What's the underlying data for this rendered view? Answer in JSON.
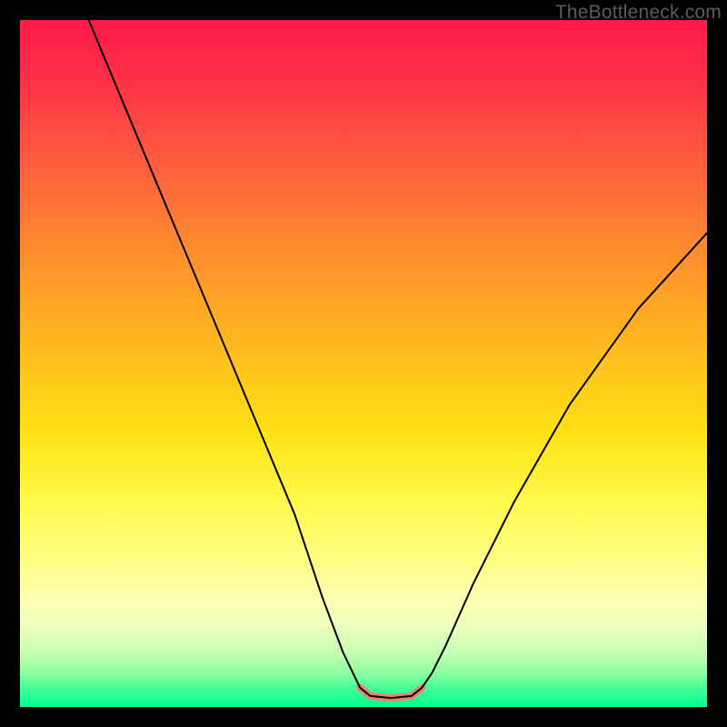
{
  "watermark": "TheBottleneck.com",
  "chart_data": {
    "type": "line",
    "title": "",
    "xlabel": "",
    "ylabel": "",
    "xlim": [
      0,
      100
    ],
    "ylim": [
      0,
      100
    ],
    "grid": false,
    "series": [
      {
        "name": "curve",
        "color": "#000000",
        "stroke_width": 2,
        "x": [
          10,
          15,
          20,
          25,
          30,
          35,
          40,
          44,
          47,
          49.5,
          51,
          54,
          57,
          58.5,
          60,
          62,
          66,
          72,
          80,
          90,
          100
        ],
        "y": [
          100,
          88,
          76,
          64,
          52,
          40,
          28,
          16,
          8,
          2.8,
          1.6,
          1.3,
          1.6,
          2.8,
          5,
          9,
          18,
          30,
          44,
          58,
          69
        ]
      },
      {
        "name": "highlight",
        "color": "#f08074",
        "stroke_width": 8,
        "x": [
          49.5,
          51,
          54,
          57,
          58.5
        ],
        "y": [
          2.8,
          1.6,
          1.3,
          1.6,
          2.8
        ]
      }
    ]
  }
}
